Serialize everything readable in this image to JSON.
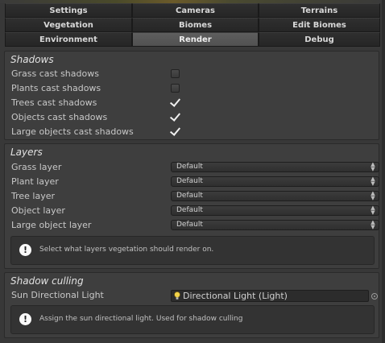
{
  "tabs": {
    "row1": [
      "Settings",
      "Cameras",
      "Terrains"
    ],
    "row2": [
      "Vegetation",
      "Biomes",
      "Edit Biomes"
    ],
    "row3": [
      "Environment",
      "Render",
      "Debug"
    ],
    "active": "Render"
  },
  "shadows": {
    "title": "Shadows",
    "items": [
      {
        "label": "Grass cast shadows",
        "checked": false
      },
      {
        "label": "Plants cast shadows",
        "checked": false
      },
      {
        "label": "Trees cast shadows",
        "checked": true
      },
      {
        "label": "Objects cast shadows",
        "checked": true
      },
      {
        "label": "Large objects cast shadows",
        "checked": true
      }
    ]
  },
  "layers": {
    "title": "Layers",
    "items": [
      {
        "label": "Grass layer",
        "value": "Default"
      },
      {
        "label": "Plant layer",
        "value": "Default"
      },
      {
        "label": "Tree layer",
        "value": "Default"
      },
      {
        "label": "Object layer",
        "value": "Default"
      },
      {
        "label": "Large object layer",
        "value": "Default"
      }
    ],
    "help": "Select what layers vegetation should render on."
  },
  "culling": {
    "title": "Shadow culling",
    "sun_label": "Sun Directional Light",
    "sun_value": "Directional Light (Light)",
    "help": "Assign the sun directional light. Used for shadow culling"
  },
  "icons": {
    "info": "info-icon",
    "light": "light-bulb-icon",
    "checkbox_on": "checkmark-icon",
    "dropdown": "up-down-arrows-icon",
    "picker": "object-picker-icon"
  },
  "colors": {
    "background": "#383838",
    "panel": "#3e3e3e",
    "active_tab": "#585858",
    "tab": "#2a2a2a",
    "text": "#c8c8c8"
  }
}
